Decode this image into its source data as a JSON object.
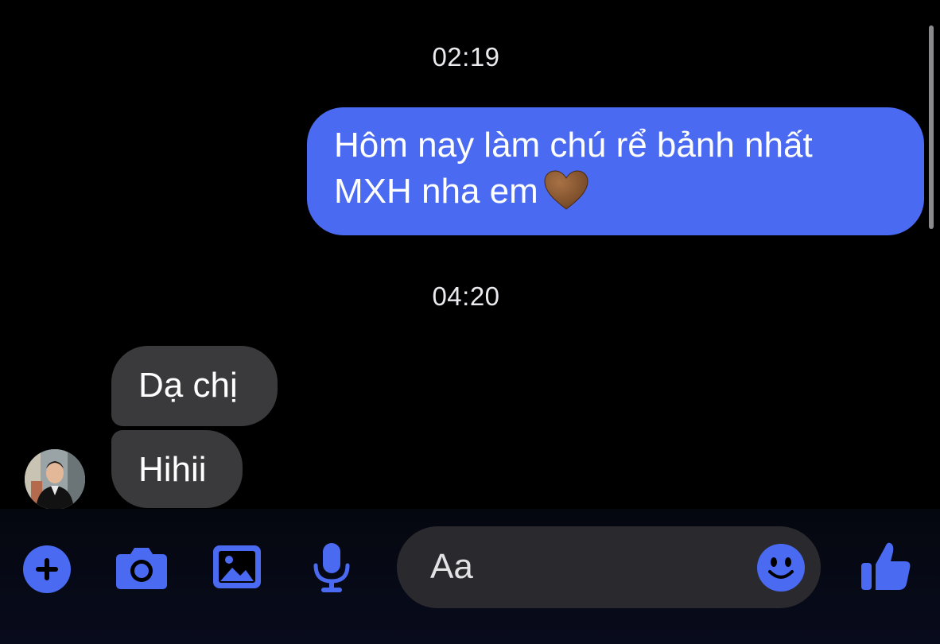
{
  "conversation": {
    "timestamps": [
      "02:19",
      "04:20"
    ],
    "outgoing": {
      "line1": "Hôm nay làm chú rể bảnh nhất",
      "line2": "MXH nha em",
      "emoji": "brown-heart-icon"
    },
    "incoming": [
      {
        "text": "Dạ chị"
      },
      {
        "text": "Hihii"
      }
    ]
  },
  "composer": {
    "placeholder": "Aa",
    "icons": [
      "plus-icon",
      "camera-icon",
      "image-icon",
      "microphone-icon",
      "smile-icon",
      "thumbs-up-icon"
    ]
  },
  "colors": {
    "accent": "#4a6af2",
    "outgoing_bubble": "#4a6af2",
    "incoming_bubble": "#3a3a3c",
    "background": "#000000"
  }
}
